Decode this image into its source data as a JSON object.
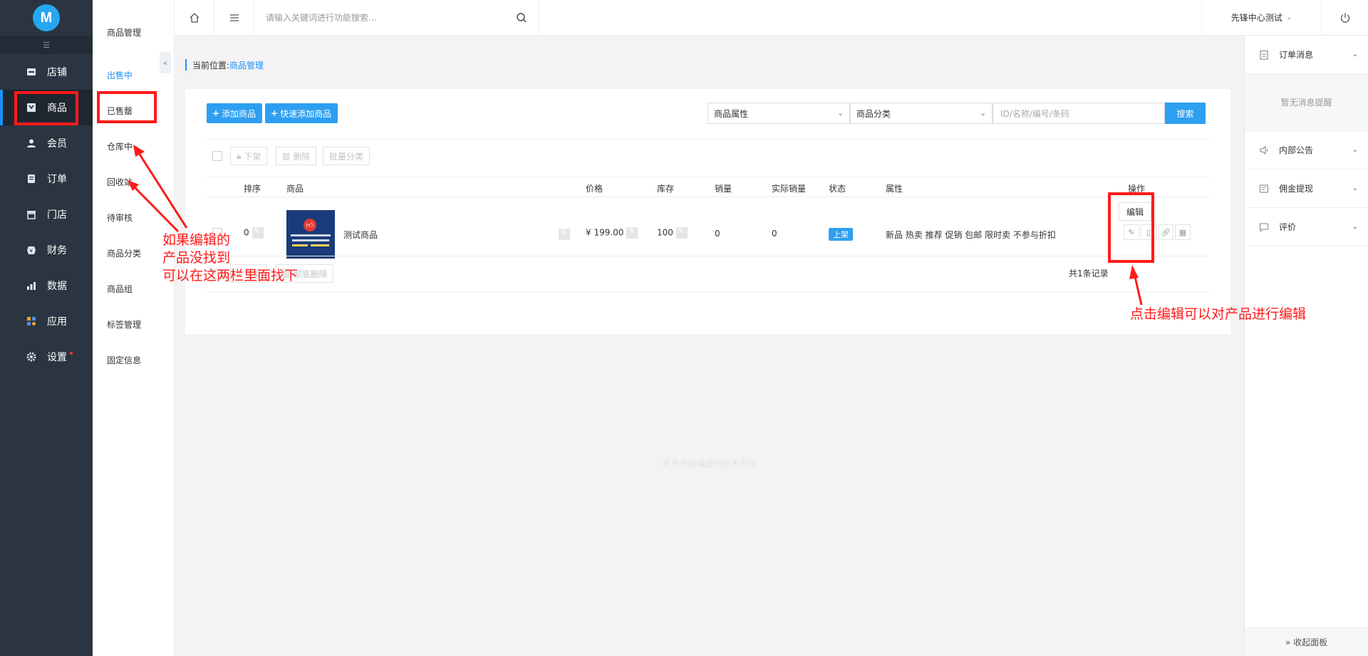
{
  "sidebar": {
    "logo": "M",
    "items": [
      {
        "label": "店铺",
        "icon": "store-icon"
      },
      {
        "label": "商品",
        "icon": "goods-icon"
      },
      {
        "label": "会员",
        "icon": "user-icon"
      },
      {
        "label": "订单",
        "icon": "order-icon"
      },
      {
        "label": "门店",
        "icon": "shop-icon"
      },
      {
        "label": "财务",
        "icon": "finance-icon"
      },
      {
        "label": "数据",
        "icon": "chart-icon"
      },
      {
        "label": "应用",
        "icon": "apps-icon"
      },
      {
        "label": "设置",
        "icon": "gear-icon"
      }
    ]
  },
  "submenu": {
    "title": "商品管理",
    "items": [
      "出售中",
      "已售罄",
      "仓库中",
      "回收站",
      "待审核",
      "商品分类",
      "商品组",
      "标签管理",
      "固定信息"
    ]
  },
  "topbar": {
    "search_placeholder": "请输入关键词进行功能搜索...",
    "user": "先锋中心测试"
  },
  "breadcrumb": {
    "prefix": "当前位置:",
    "current": "商品管理"
  },
  "toolbar": {
    "add_label": "添加商品",
    "quick_add_label": "快速添加商品",
    "attr_select": "商品属性",
    "category_select": "商品分类",
    "search_placeholder": "ID/名称/编号/条码",
    "search_btn": "搜索"
  },
  "bulk": {
    "off_shelf": "下架",
    "delete": "删除",
    "batch_category": "批量分类",
    "perm_delete": "彻底删除"
  },
  "table": {
    "headers": {
      "sort": "排序",
      "goods": "商品",
      "price": "价格",
      "stock": "库存",
      "sales": "销量",
      "real_sales": "实际销量",
      "status": "状态",
      "attrs": "属性",
      "ops": "操作"
    },
    "rows": [
      {
        "sort": "0",
        "name": "测试商品",
        "price": "¥ 199.00",
        "stock": "100",
        "sales": "0",
        "real_sales": "0",
        "status": "上架",
        "attrs": "新品 热卖 推荐 促销 包邮 限时卖 不参与折扣",
        "edit": "编辑"
      }
    ],
    "total": "共1条记录"
  },
  "footer_note": "米多米商城提供技术支持",
  "right_panel": {
    "order_msg": "订单消息",
    "empty": "暂无消息提醒",
    "notice": "内部公告",
    "commission": "佣金提现",
    "review": "评价",
    "collapse": "» 收起面板"
  },
  "annotations": {
    "left": [
      "如果编辑的",
      "产品没找到",
      "可以在这两栏里面找下"
    ],
    "right": "点击编辑可以对产品进行编辑"
  },
  "colors": {
    "accent": "#2d9ff1",
    "sidebar_bg": "#2b3542",
    "annotation": "#ff1a1a"
  }
}
